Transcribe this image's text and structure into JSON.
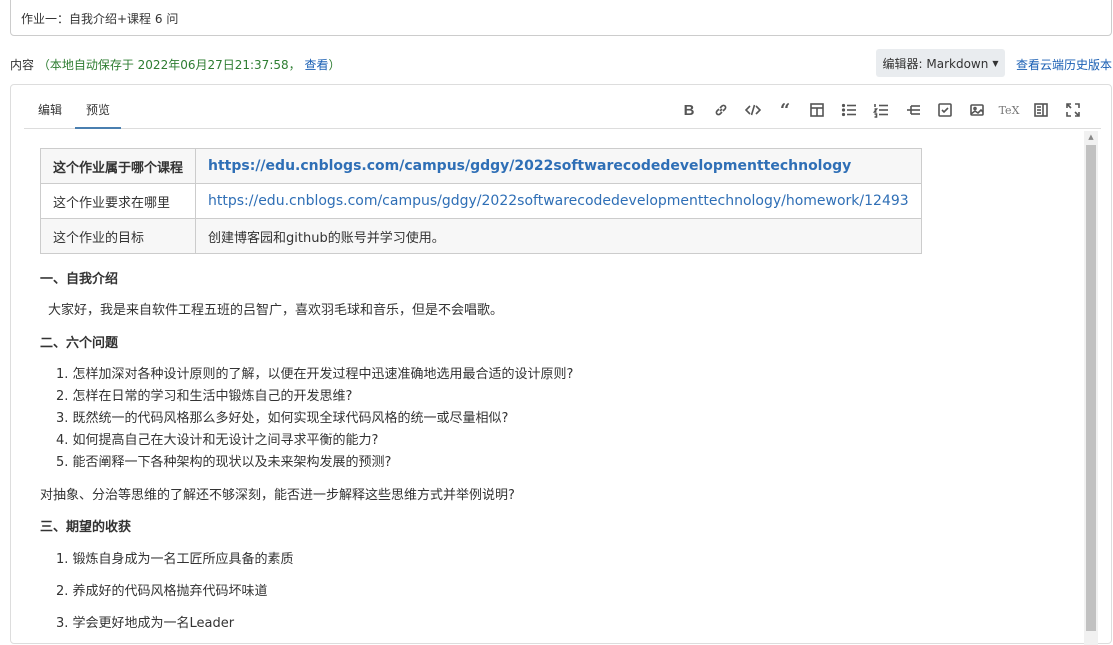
{
  "title_field": {
    "value": "作业一：自我介绍+课程 6 问"
  },
  "content_label": {
    "label": "内容",
    "autosave": "（本地自动保存于 2022年06月27日21:37:58，",
    "view_link": "查看",
    "close_paren": "）"
  },
  "editor_select": {
    "label": "编辑器: Markdown"
  },
  "history_link": "查看云端历史版本",
  "tabs": {
    "edit": "编辑",
    "preview": "预览"
  },
  "toolbar": {
    "items": [
      {
        "name": "bold-icon",
        "glyph": "B"
      },
      {
        "name": "link-icon"
      },
      {
        "name": "code-icon"
      },
      {
        "name": "quote-icon"
      },
      {
        "name": "table-icon"
      },
      {
        "name": "bullet-list-icon"
      },
      {
        "name": "numbered-list-icon"
      },
      {
        "name": "outline-icon"
      },
      {
        "name": "checkbox-icon"
      },
      {
        "name": "image-icon"
      },
      {
        "name": "tex-icon",
        "glyph": "TeX"
      },
      {
        "name": "split-view-icon"
      },
      {
        "name": "fullscreen-icon"
      }
    ]
  },
  "preview": {
    "table": [
      {
        "key": "这个作业属于哪个课程",
        "value": "https://edu.cnblogs.com/campus/gdgy/2022softwarecodedevelopmenttechnology"
      },
      {
        "key": "这个作业要求在哪里",
        "value": "https://edu.cnblogs.com/campus/gdgy/2022softwarecodedevelopmenttechnology/homework/12493"
      },
      {
        "key": "这个作业的目标",
        "value": "创建博客园和github的账号并学习使用。"
      }
    ],
    "section1_title": "一、自我介绍",
    "intro": "大家好，我是来自软件工程五班的吕智广，喜欢羽毛球和音乐，但是不会唱歌。",
    "section2_title": "二、六个问题",
    "questions": [
      "1. 怎样加深对各种设计原则的了解，以便在开发过程中迅速准确地选用最合适的设计原则?",
      "2. 怎样在日常的学习和生活中锻炼自己的开发思维?",
      "3. 既然统一的代码风格那么多好处，如何实现全球代码风格的统一或尽量相似?",
      "4. 如何提高自己在大设计和无设计之间寻求平衡的能力?",
      "5. 能否阐释一下各种架构的现状以及未来架构发展的预测?"
    ],
    "question6": "对抽象、分治等思维的了解还不够深刻，能否进一步解释这些思维方式并举例说明?",
    "section3_title": "三、期望的收获",
    "gains": [
      "1. 锻炼自身成为一名工匠所应具备的素质",
      "2. 养成好的代码风格抛弃代码坏味道",
      "3. 学会更好地成为一名Leader"
    ]
  }
}
